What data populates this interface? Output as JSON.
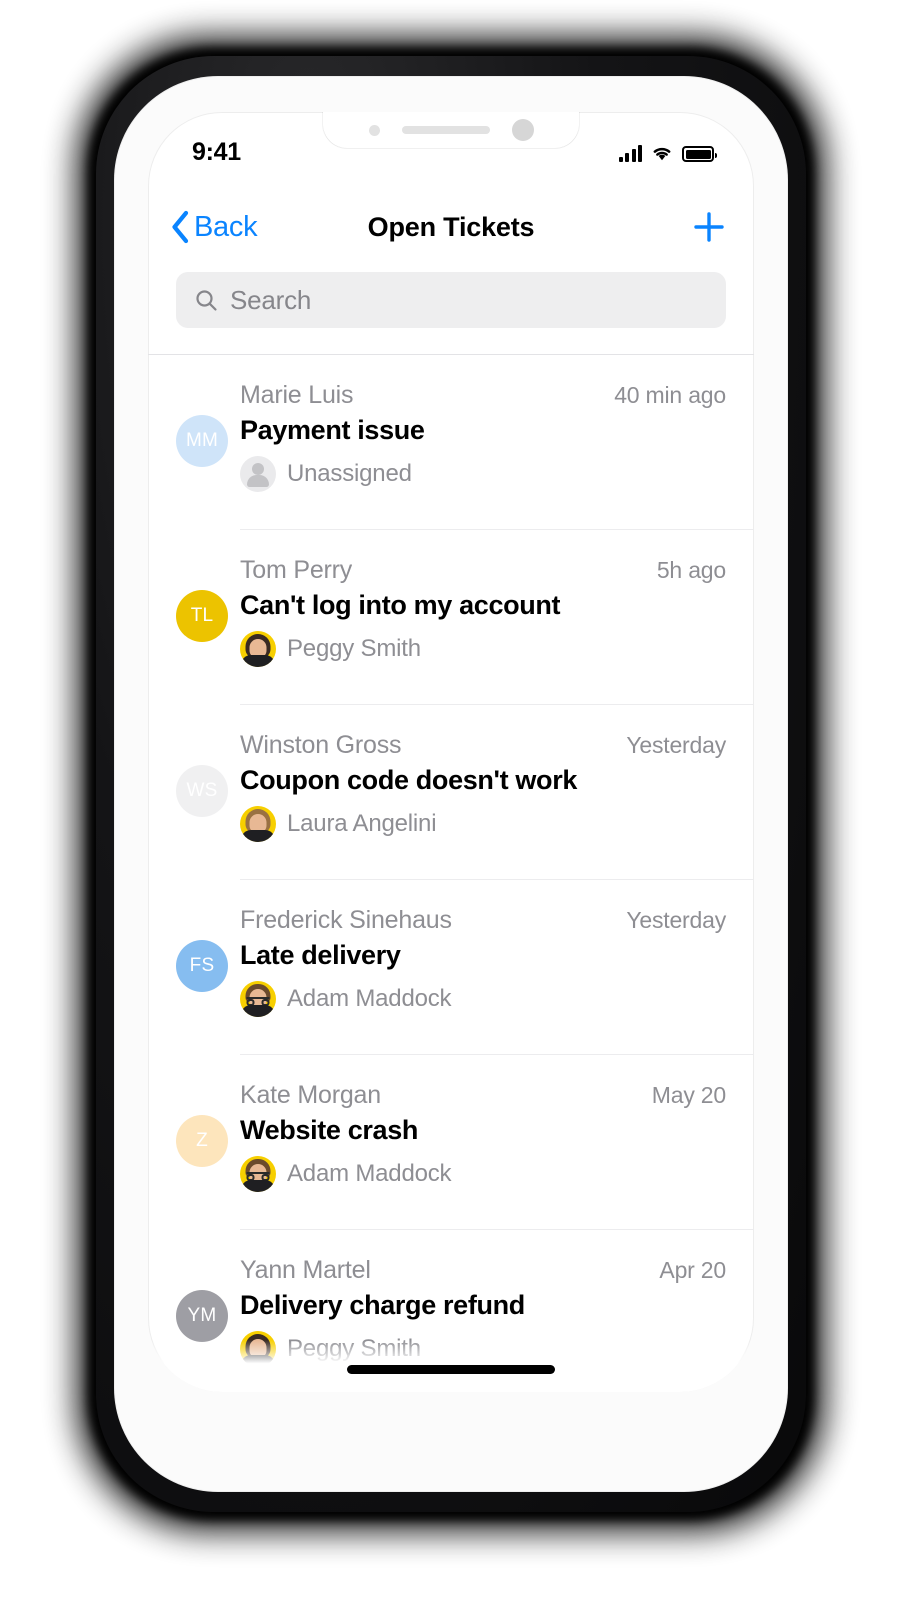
{
  "status_bar": {
    "time": "9:41",
    "signal_icon": "signal-bars-icon",
    "wifi_icon": "wifi-icon",
    "battery_icon": "battery-icon"
  },
  "nav": {
    "back_label": "Back",
    "title": "Open Tickets",
    "add_label": "+"
  },
  "search": {
    "placeholder": "Search",
    "value": "",
    "icon": "search-icon"
  },
  "colors": {
    "accent": "#0a84ff",
    "yellow": "#f0c000",
    "search_background": "#eeeeef",
    "muted_text": "#8e8e93"
  },
  "tickets": [
    {
      "requester": "Marie Luis",
      "timestamp": "40 min ago",
      "subject": "Payment issue",
      "assignee": "Unassigned",
      "assignee_type": "unassigned",
      "initials": "MM",
      "avatar_color": "#cfe4f9"
    },
    {
      "requester": "Tom Perry",
      "timestamp": "5h ago",
      "subject": "Can't log into my account",
      "assignee": "Peggy Smith",
      "assignee_type": "photo-female-dark",
      "initials": "TL",
      "avatar_color": "#ecc300"
    },
    {
      "requester": "Winston Gross",
      "timestamp": "Yesterday",
      "subject": "Coupon code doesn't work",
      "assignee": "Laura Angelini",
      "assignee_type": "photo-female-blonde",
      "initials": "WS",
      "avatar_color": "#f0f0f1"
    },
    {
      "requester": "Frederick Sinehaus",
      "timestamp": "Yesterday",
      "subject": "Late delivery",
      "assignee": "Adam Maddock",
      "assignee_type": "photo-male-glasses",
      "initials": "FS",
      "avatar_color": "#86bdf0"
    },
    {
      "requester": "Kate Morgan",
      "timestamp": "May 20",
      "subject": "Website crash",
      "assignee": "Adam Maddock",
      "assignee_type": "photo-male-glasses",
      "initials": "Z",
      "avatar_color": "#fde5bc"
    },
    {
      "requester": "Yann Martel",
      "timestamp": "Apr 20",
      "subject": "Delivery charge refund",
      "assignee": "Peggy Smith",
      "assignee_type": "photo-female-dark",
      "initials": "YM",
      "avatar_color": "#9e9ea4"
    }
  ]
}
